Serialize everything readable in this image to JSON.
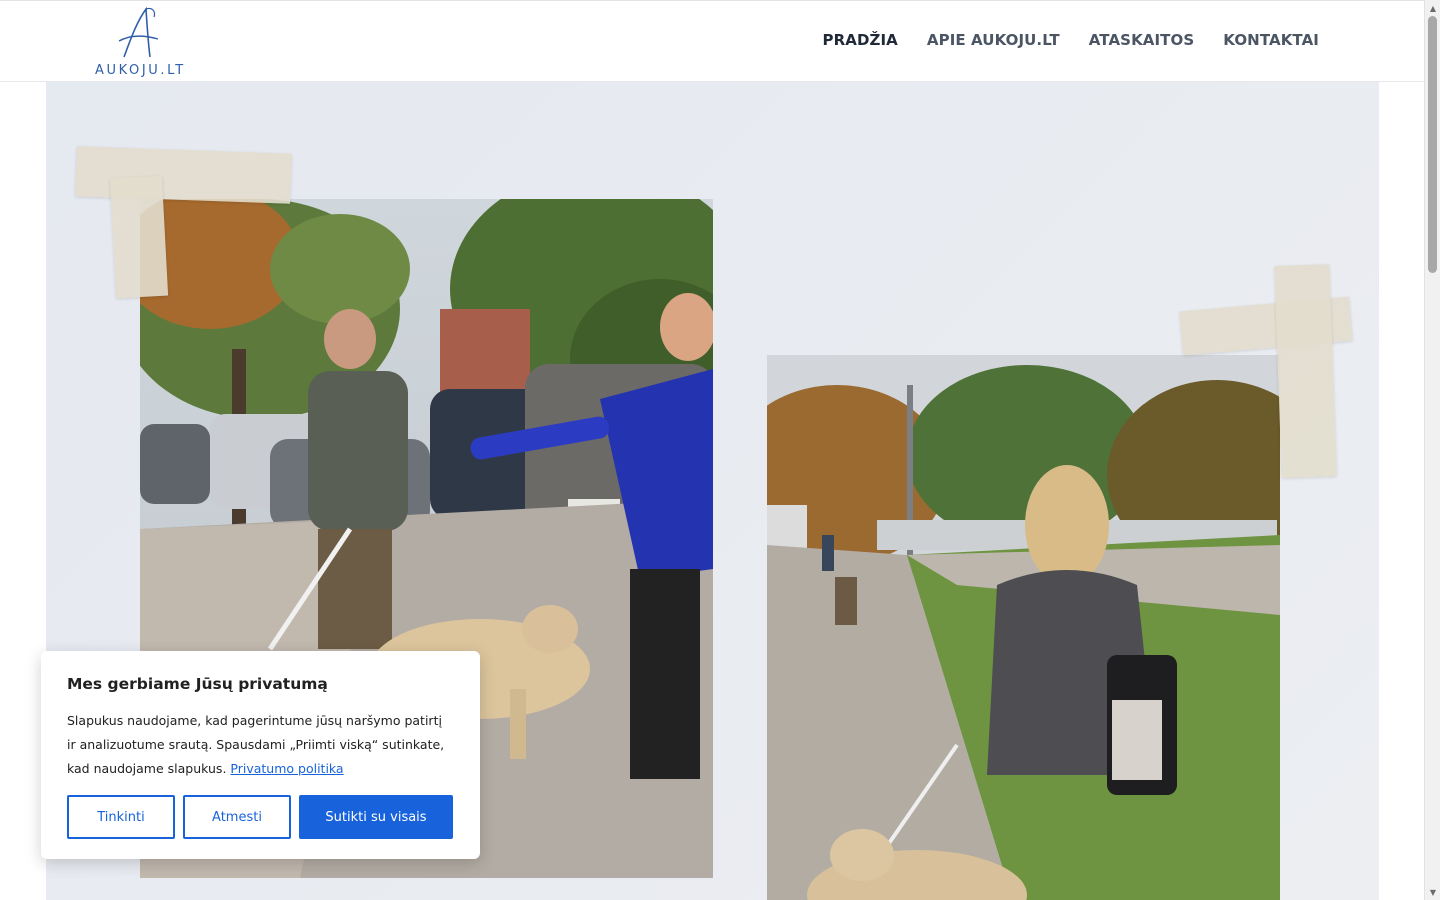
{
  "header": {
    "logo_text": "AUKOJU.LT",
    "nav": [
      {
        "label": "PRADŽIA",
        "active": true
      },
      {
        "label": "APIE AUKOJU.LT",
        "active": false
      },
      {
        "label": "ATASKAITOS",
        "active": false
      },
      {
        "label": "KONTAKTAI",
        "active": false
      }
    ]
  },
  "hero": {
    "photos": [
      {
        "subject": "man with white cane and guide dog, woman in blue jacket pointing, parking lot"
      },
      {
        "subject": "woman with backpack walking guide dog on paved path in park"
      }
    ]
  },
  "cookie_banner": {
    "title": "Mes gerbiame Jūsų privatumą",
    "text": "Slapukus naudojame, kad pagerintume jūsų naršymo patirtį ir analizuotume srautą. Spausdami „Priimti viską“ sutinkate, kad naudojame slapukus.",
    "link_label": "Privatumo politika",
    "buttons": {
      "customize": "Tinkinti",
      "reject": "Atmesti",
      "accept": "Sutikti su visais"
    }
  },
  "colors": {
    "accent": "#1863dc",
    "logo": "#2f5fa8",
    "hero_bg": "#e7eaf0"
  },
  "icons": {
    "scroll_up": "triangle-up-icon",
    "scroll_down": "triangle-down-icon"
  }
}
